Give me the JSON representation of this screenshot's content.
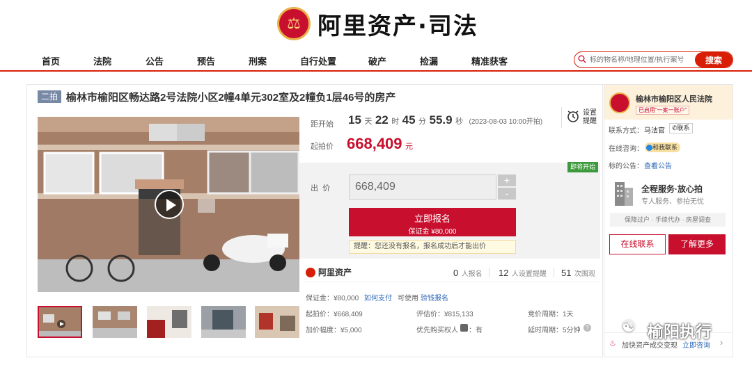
{
  "header": {
    "logo_text": "阿里资产·司法"
  },
  "nav": [
    "首页",
    "法院",
    "公告",
    "预告",
    "刑案",
    "自行处置",
    "破产",
    "捡漏",
    "精准获客"
  ],
  "search": {
    "placeholder": "标的物名称/地理位置/执行案号",
    "button": "搜索"
  },
  "item": {
    "round_badge": "二拍",
    "title": "榆林市榆阳区畅达路2号法院小区2幢4单元302室及2幢负1层46号的房产",
    "countdown": {
      "label": "距开始",
      "days": "15",
      "days_unit": "天",
      "hours": "22",
      "hours_unit": "时",
      "minutes": "45",
      "minutes_unit": "分",
      "seconds": "55.9",
      "seconds_unit": "秒",
      "start_time": "(2023-08-03 10:00开拍)"
    },
    "reminder": {
      "line1": "设置",
      "line2": "提醒"
    },
    "start_price_label": "起拍价",
    "start_price": "668,409",
    "currency": "元",
    "status_tag": "即将开始",
    "bid_label": "出  价",
    "bid_value": "668,409",
    "plus": "+",
    "minus": "-",
    "signup": {
      "label": "立即报名",
      "deposit": "保证金 ¥80,000"
    },
    "tip": "提醒：您还没有报名，报名成功后才能出价"
  },
  "stats": {
    "brand": "阿里资产",
    "signups": "0",
    "signups_unit": "人报名",
    "reminders": "12",
    "reminders_unit": "人设置提醒",
    "views": "51",
    "views_unit": "次围观"
  },
  "details": {
    "deposit": "保证金：¥80,000",
    "how_pay": "如何支付",
    "can_use": "可使用",
    "loan": "验钱报名",
    "start_price": "起拍价：¥668,409",
    "appraisal": "评估价：¥815,133",
    "cycle": "竞价周期：1天",
    "increment": "加价幅度：¥5,000",
    "priority_label": "优先购买权人",
    "priority_value": "：有",
    "delay": "延时周期：5分钟"
  },
  "court": {
    "name": "榆林市榆阳区人民法院",
    "tag": "已启用“一案一账户”",
    "contact_label": "联系方式：",
    "contact_name": "马法官",
    "contact_btn": "联系",
    "consult_label": "在线咨询：",
    "consult_btn": "和我联系",
    "notice_label": "标的公告：",
    "notice_link": "查看公告"
  },
  "service": {
    "title": "全程服务·放心拍",
    "subtitle": "专人服务、参拍无忧",
    "features": "保障过户 · 手续代办 · 房屋调查",
    "online_btn": "在线联系",
    "more_btn": "了解更多"
  },
  "footer": {
    "text": "加快资产成交变现",
    "link": "立即咨询"
  },
  "watermark": "榆阳执行",
  "colors": {
    "accent": "#c8102e",
    "nav_line": "#d81e06",
    "gold": "#e9b24a"
  }
}
